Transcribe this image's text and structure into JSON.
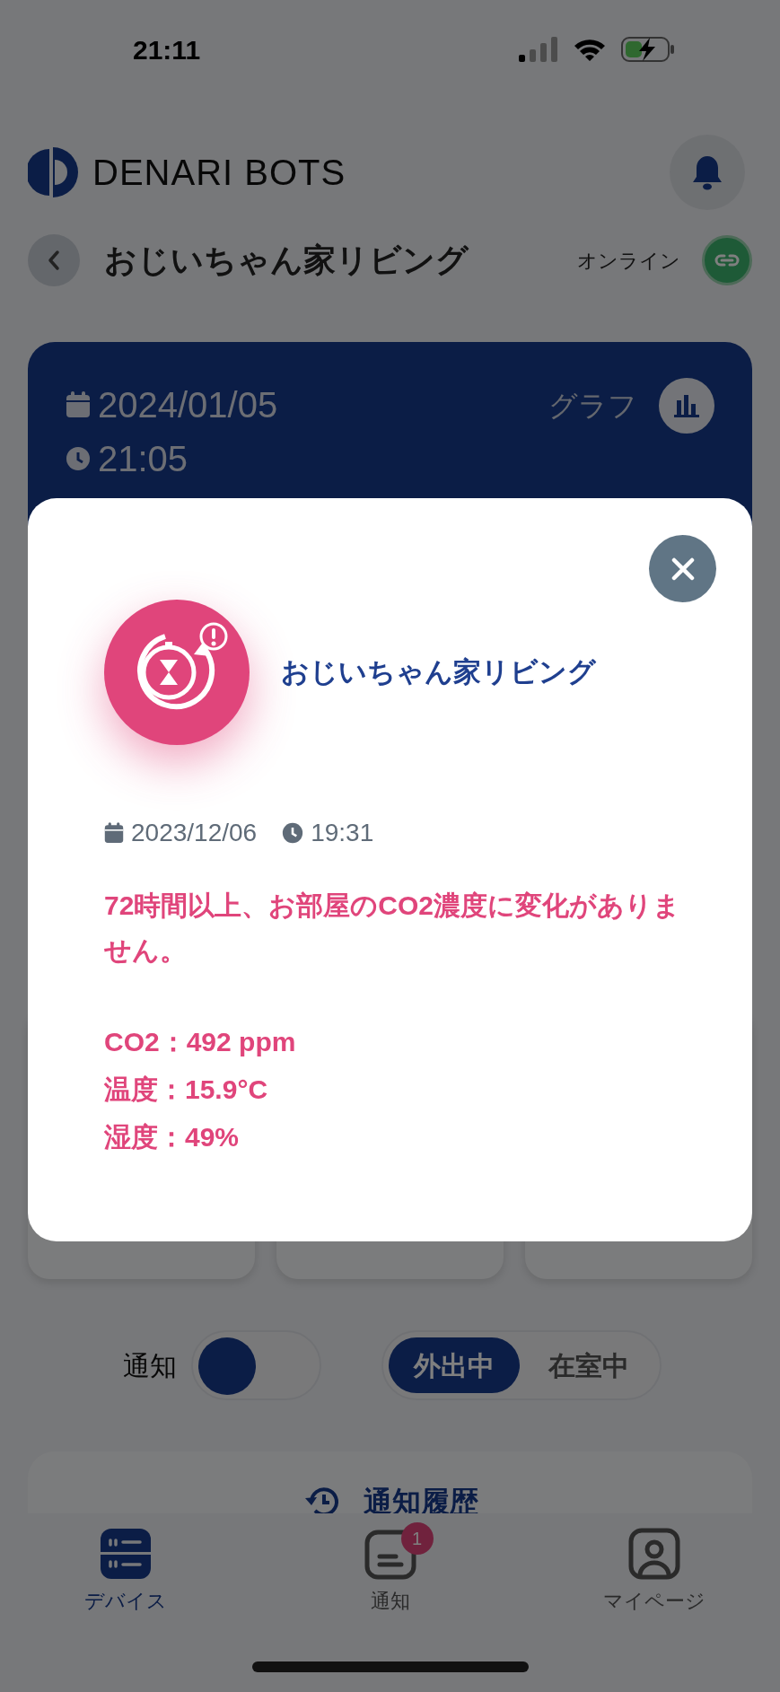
{
  "status_bar": {
    "time": "21:11"
  },
  "header": {
    "logo_text": "DENARI BOTS"
  },
  "device": {
    "title": "おじいちゃん家リビング",
    "status": "オンライン"
  },
  "reading_card": {
    "date": "2024/01/05",
    "time": "21:05",
    "graph_label": "グラフ"
  },
  "notification_toggle": {
    "label": "通知",
    "on": false
  },
  "mode_segment": [
    {
      "label": "外出中",
      "selected": true
    },
    {
      "label": "在室中",
      "selected": false
    }
  ],
  "history": {
    "title": "通知履歴"
  },
  "tab_bar": [
    {
      "label": "デバイス",
      "kind": "devices",
      "selected": true
    },
    {
      "label": "通知",
      "kind": "notices",
      "selected": false,
      "badge": "1"
    },
    {
      "label": "マイページ",
      "kind": "profile",
      "selected": false
    }
  ],
  "modal": {
    "device_name": "おじいちゃん家リビング",
    "date": "2023/12/06",
    "time": "19:31",
    "message": "72時間以上、お部屋のCO2濃度に変化がありません。",
    "readings": [
      "CO2：492 ppm",
      "温度：15.9°C",
      "湿度：49%"
    ]
  }
}
